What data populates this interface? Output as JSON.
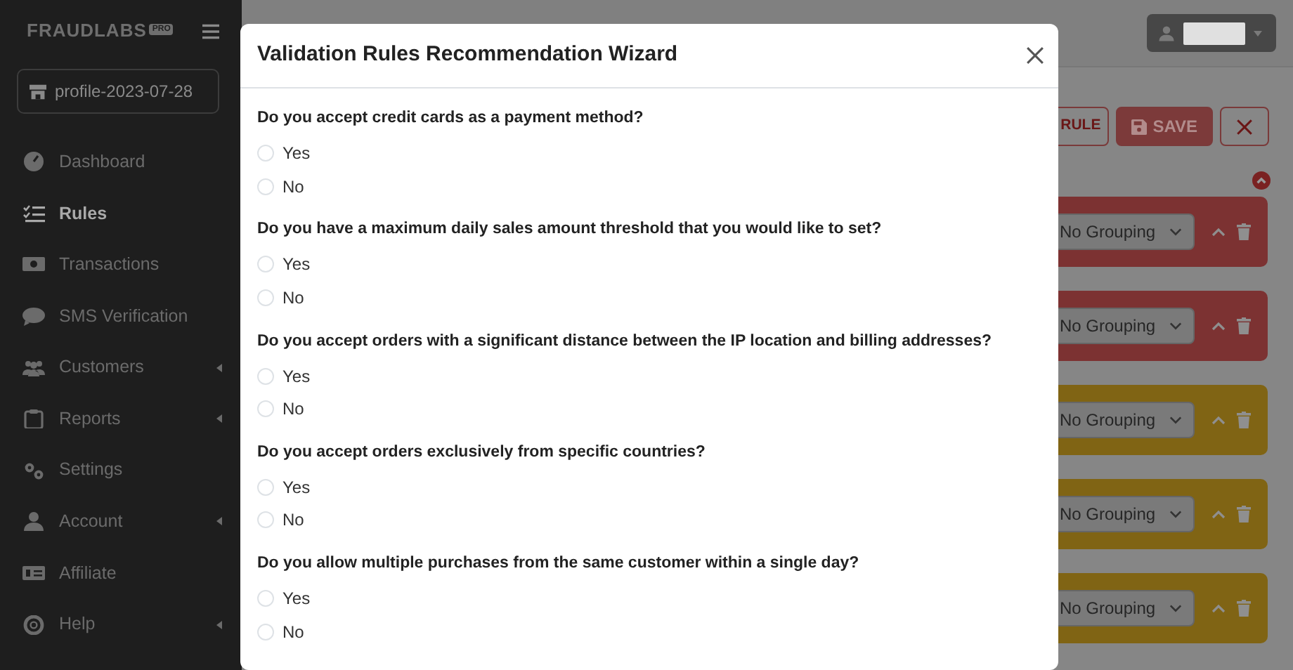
{
  "sidebar": {
    "logo": "FRAUDLABS",
    "logo_badge": "PRO",
    "profile": "profile-2023-07-28",
    "items": [
      {
        "label": "Dashboard",
        "selected": false,
        "has_submenu": false
      },
      {
        "label": "Rules",
        "selected": true,
        "has_submenu": false
      },
      {
        "label": "Transactions",
        "selected": false,
        "has_submenu": false
      },
      {
        "label": "SMS Verification",
        "selected": false,
        "has_submenu": false
      },
      {
        "label": "Customers",
        "selected": false,
        "has_submenu": true
      },
      {
        "label": "Reports",
        "selected": false,
        "has_submenu": true
      },
      {
        "label": "Settings",
        "selected": false,
        "has_submenu": false
      },
      {
        "label": "Account",
        "selected": false,
        "has_submenu": true
      },
      {
        "label": "Affiliate",
        "selected": false,
        "has_submenu": false
      },
      {
        "label": "Help",
        "selected": false,
        "has_submenu": true
      }
    ]
  },
  "toolbar": {
    "buttons": [
      {
        "kind": "outline",
        "label": "RULE"
      },
      {
        "kind": "filled",
        "label": "SAVE"
      },
      {
        "kind": "icon"
      }
    ]
  },
  "rules": [
    {
      "color": "#7c3232",
      "grouping": "No Grouping"
    },
    {
      "color": "#7c3232",
      "grouping": "No Grouping"
    },
    {
      "color": "#806414",
      "grouping": "No Grouping"
    },
    {
      "color": "#806414",
      "grouping": "No Grouping"
    },
    {
      "color": "#806414",
      "grouping": "No Grouping"
    }
  ],
  "modal": {
    "title": "Validation Rules Recommendation Wizard",
    "questions": [
      {
        "text": "Do you accept credit cards as a payment method?",
        "options": [
          {
            "label": "Yes",
            "selected": false
          },
          {
            "label": "No",
            "selected": false
          }
        ]
      },
      {
        "text": "Do you have a maximum daily sales amount threshold that you would like to set?",
        "options": [
          {
            "label": "Yes",
            "selected": false
          },
          {
            "label": "No",
            "selected": false
          }
        ]
      },
      {
        "text": "Do you accept orders with a significant distance between the IP location and billing addresses?",
        "options": [
          {
            "label": "Yes",
            "selected": false
          },
          {
            "label": "No",
            "selected": false
          }
        ]
      },
      {
        "text": "Do you accept orders exclusively from specific countries?",
        "options": [
          {
            "label": "Yes",
            "selected": false
          },
          {
            "label": "No",
            "selected": false
          }
        ]
      },
      {
        "text": "Do you allow multiple purchases from the same customer within a single day?",
        "options": [
          {
            "label": "Yes",
            "selected": false
          },
          {
            "label": "No",
            "selected": false
          }
        ]
      }
    ]
  }
}
